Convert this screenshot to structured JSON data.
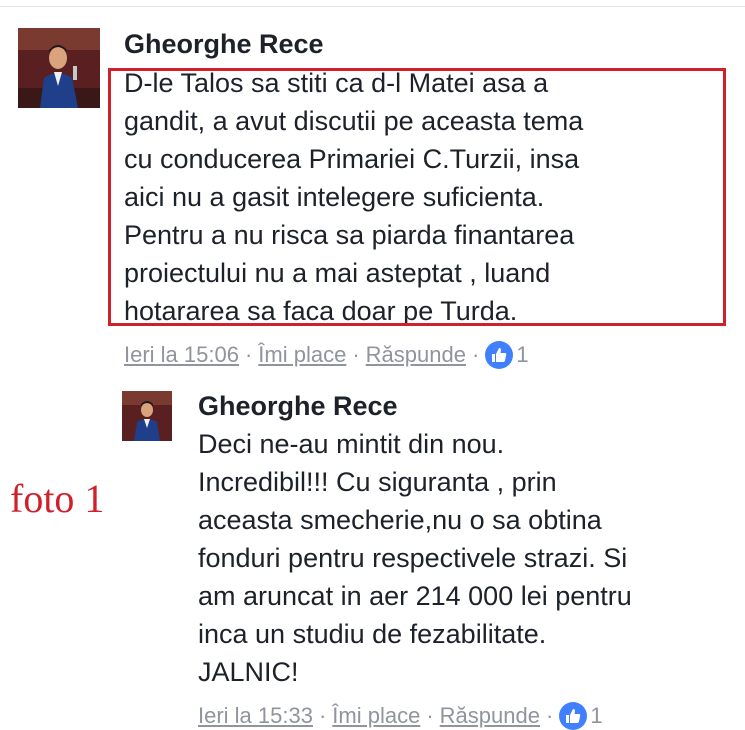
{
  "comments": [
    {
      "author": "Gheorghe Rece",
      "text": "D-le Talos sa stiti ca d-l Matei asa a\ngandit, a avut discutii pe aceasta tema\ncu conducerea Primariei C.Turzii, insa\naici nu a gasit intelegere  suficienta.\nPentru a nu risca sa piarda finantarea\nproiectului nu a mai asteptat , luand\nhotararea sa faca doar pe Turda.",
      "timestamp": "Ieri la 15:06",
      "like_label": "Îmi place",
      "reply_label": "Răspunde",
      "reaction_count": "1"
    },
    {
      "author": "Gheorghe Rece",
      "text": "Deci ne-au mintit din nou.\nIncredibil!!!  Cu siguranta , prin\naceasta smecherie,nu o sa obtina\nfonduri pentru respectivele strazi. Si\nam aruncat in aer 214 000 lei pentru\ninca un studiu de fezabilitate.\nJALNIC!",
      "timestamp": "Ieri la 15:33",
      "like_label": "Îmi place",
      "reply_label": "Răspunde",
      "reaction_count": "1"
    }
  ],
  "separator": "·",
  "annotation": "foto 1",
  "colors": {
    "highlight": "#d0202a",
    "like_badge": "#4080ff",
    "meta_text": "#90949c"
  },
  "icons": {
    "reaction": "thumbs-up-icon"
  }
}
